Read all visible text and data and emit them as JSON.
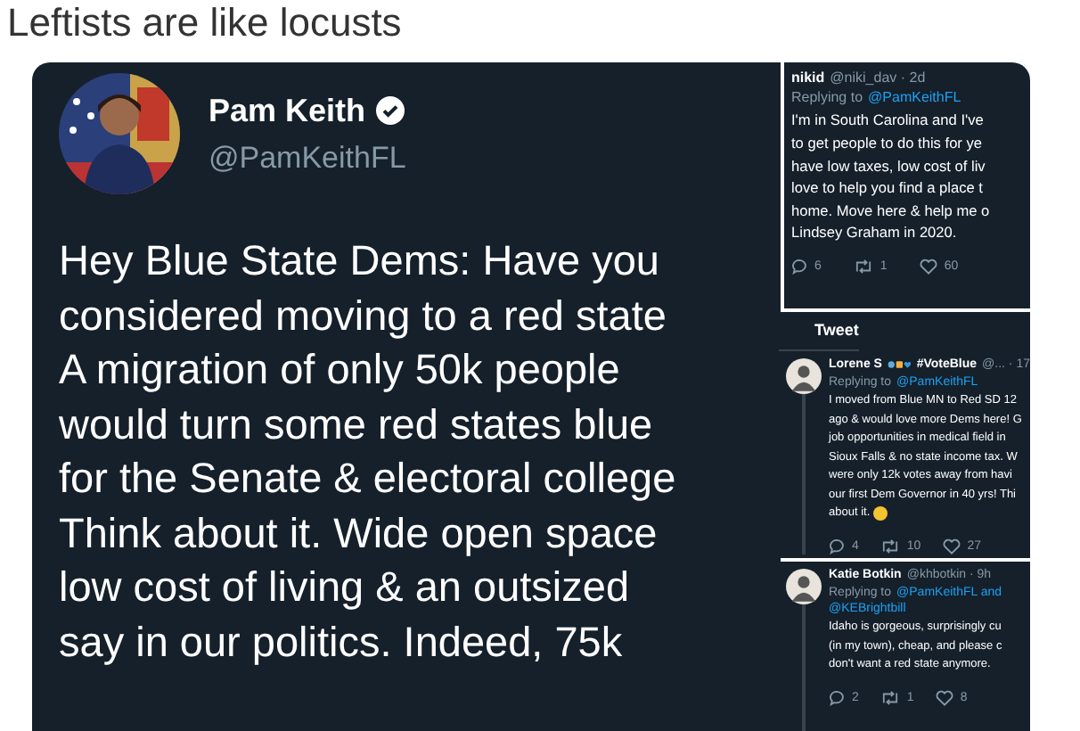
{
  "title": "Leftists are like locusts",
  "main_tweet": {
    "name": "Pam Keith",
    "verified": true,
    "handle": "@PamKeithFL",
    "lines": [
      "Hey Blue State Dems: Have you",
      "considered moving to a red state",
      "A migration of only 50k people",
      "would turn some red states blue",
      "for the Senate & electoral college",
      "Think about it. Wide open space",
      "low cost of living & an outsized",
      "say in our politics. Indeed, 75k"
    ]
  },
  "replies": [
    {
      "has_avatar": false,
      "name": "nikid",
      "handle": "@niki_dav · 2d",
      "replying": [
        {
          "kind": "plain",
          "text": "Replying to"
        },
        {
          "kind": "mention",
          "text": "@PamKeithFL"
        }
      ],
      "lines": [
        "I'm in South Carolina and I've",
        "to get people to do this for ye",
        "have low taxes, low cost of liv",
        "love to help you find a place t",
        "home. Move here & help me o",
        "Lindsey Graham in 2020."
      ],
      "trailing_emoji": false,
      "counts": {
        "reply": "6",
        "retweet": "1",
        "like": "60"
      }
    },
    {
      "header": "Tweet",
      "has_avatar": true,
      "name": "Lorene S",
      "name_tag": "#VoteBlue",
      "handle": "@... · 17",
      "replying": [
        {
          "kind": "plain",
          "text": "Replying to"
        },
        {
          "kind": "mention",
          "text": "@PamKeithFL"
        }
      ],
      "lines": [
        "I moved from Blue MN to Red SD 12",
        "ago & would love more Dems here! G",
        "job opportunities in medical field in",
        "Sioux Falls & no state income tax. W",
        "were only 12k votes away from havi",
        "our first Dem Governor in 40 yrs! Thi",
        "about it."
      ],
      "trailing_emoji": true,
      "counts": {
        "reply": "4",
        "retweet": "10",
        "like": "27"
      }
    },
    {
      "has_avatar": true,
      "name": "Katie Botkin",
      "handle": "@khbotkin · 9h",
      "replying": [
        {
          "kind": "plain",
          "text": "Replying to"
        },
        {
          "kind": "mention",
          "text": "@PamKeithFL and"
        },
        {
          "kind": "mention",
          "text": "@KEBrightbill"
        }
      ],
      "lines": [
        "Idaho is gorgeous, surprisingly cu",
        "(in my town), cheap, and please c",
        "don't want a red state anymore."
      ],
      "trailing_emoji": false,
      "counts": {
        "reply": "2",
        "retweet": "1",
        "like": "8"
      }
    }
  ]
}
